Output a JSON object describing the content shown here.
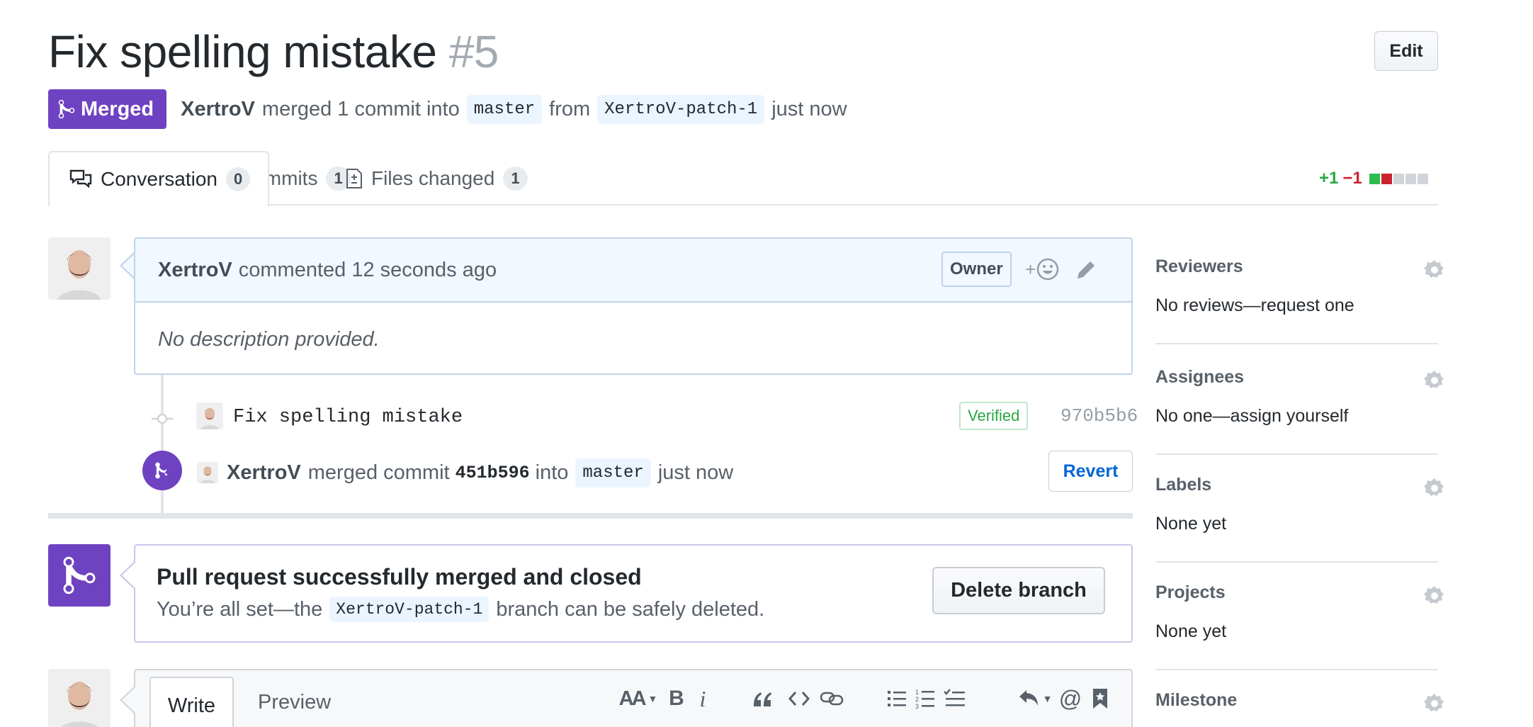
{
  "pr": {
    "title": "Fix spelling mistake",
    "number": "#5",
    "edit_label": "Edit",
    "state_label": "Merged",
    "author": "XertroV",
    "summary_mid": "merged 1 commit into",
    "base_branch": "master",
    "from_word": "from",
    "head_branch": "XertroV-patch-1",
    "time": "just now"
  },
  "tabs": [
    {
      "label": "Conversation",
      "count": "0"
    },
    {
      "label": "Commits",
      "count": "1"
    },
    {
      "label": "Files changed",
      "count": "1"
    }
  ],
  "diffstat": {
    "additions": "+1",
    "deletions": "−1"
  },
  "comment": {
    "author": "XertroV",
    "action": "commented 12 seconds ago",
    "role": "Owner",
    "reaction_plus": "+",
    "body": "No description provided."
  },
  "commit": {
    "message": "Fix spelling mistake",
    "verified_label": "Verified",
    "sha": "970b5b6"
  },
  "merge_event": {
    "author": "XertroV",
    "action": "merged commit",
    "sha": "451b596",
    "into_word": "into",
    "branch": "master",
    "time": "just now",
    "revert_label": "Revert"
  },
  "merged_notice": {
    "title": "Pull request successfully merged and closed",
    "desc_before": "You’re all set—the",
    "branch": "XertroV-patch-1",
    "desc_after": "branch can be safely deleted.",
    "delete_label": "Delete branch"
  },
  "editor": {
    "write_label": "Write",
    "preview_label": "Preview",
    "heading_tool": "AA",
    "bold_tool": "B",
    "italic_tool": "i",
    "mention_tool": "@"
  },
  "sidebar": {
    "sections": [
      {
        "title": "Reviewers",
        "value": "No reviews—request one"
      },
      {
        "title": "Assignees",
        "value": "No one—assign yourself"
      },
      {
        "title": "Labels",
        "value": "None yet"
      },
      {
        "title": "Projects",
        "value": "None yet"
      },
      {
        "title": "Milestone",
        "value": ""
      }
    ]
  },
  "colors": {
    "merged_purple": "#6f42c1",
    "link_blue": "#0366d6",
    "addition_green": "#28a745",
    "deletion_red": "#cb2431"
  }
}
